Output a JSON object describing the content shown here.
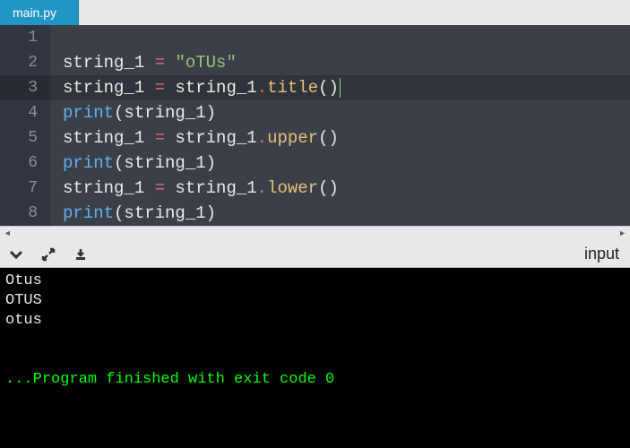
{
  "tab": {
    "filename": "main.py"
  },
  "editor": {
    "current_line": 3,
    "lines": [
      {
        "n": "1",
        "tokens": []
      },
      {
        "n": "2",
        "tokens": [
          {
            "t": "string_1 ",
            "c": "tok-id"
          },
          {
            "t": "=",
            "c": "tok-op"
          },
          {
            "t": " ",
            "c": ""
          },
          {
            "t": "\"oTUs\"",
            "c": "tok-str"
          }
        ]
      },
      {
        "n": "3",
        "tokens": [
          {
            "t": "string_1 ",
            "c": "tok-id"
          },
          {
            "t": "=",
            "c": "tok-op"
          },
          {
            "t": " string_1",
            "c": "tok-id"
          },
          {
            "t": ".",
            "c": "tok-op"
          },
          {
            "t": "title",
            "c": "tok-call"
          },
          {
            "t": "()",
            "c": "tok-id"
          }
        ]
      },
      {
        "n": "4",
        "tokens": [
          {
            "t": "print",
            "c": "tok-fn"
          },
          {
            "t": "(string_1)",
            "c": "tok-id"
          }
        ]
      },
      {
        "n": "5",
        "tokens": [
          {
            "t": "string_1 ",
            "c": "tok-id"
          },
          {
            "t": "=",
            "c": "tok-op"
          },
          {
            "t": " string_1",
            "c": "tok-id"
          },
          {
            "t": ".",
            "c": "tok-op"
          },
          {
            "t": "upper",
            "c": "tok-call"
          },
          {
            "t": "()",
            "c": "tok-id"
          }
        ]
      },
      {
        "n": "6",
        "tokens": [
          {
            "t": "print",
            "c": "tok-fn"
          },
          {
            "t": "(string_1)",
            "c": "tok-id"
          }
        ]
      },
      {
        "n": "7",
        "tokens": [
          {
            "t": "string_1 ",
            "c": "tok-id"
          },
          {
            "t": "=",
            "c": "tok-op"
          },
          {
            "t": " string_1",
            "c": "tok-id"
          },
          {
            "t": ".",
            "c": "tok-op"
          },
          {
            "t": "lower",
            "c": "tok-call"
          },
          {
            "t": "()",
            "c": "tok-id"
          }
        ]
      },
      {
        "n": "8",
        "tokens": [
          {
            "t": "print",
            "c": "tok-fn"
          },
          {
            "t": "(string_1)",
            "c": "tok-id"
          }
        ]
      }
    ]
  },
  "toolbar": {
    "input_label": "input"
  },
  "console": {
    "lines": [
      "Otus",
      "OTUS",
      "otus",
      "",
      ""
    ],
    "exit_msg": "...Program finished with exit code 0"
  }
}
